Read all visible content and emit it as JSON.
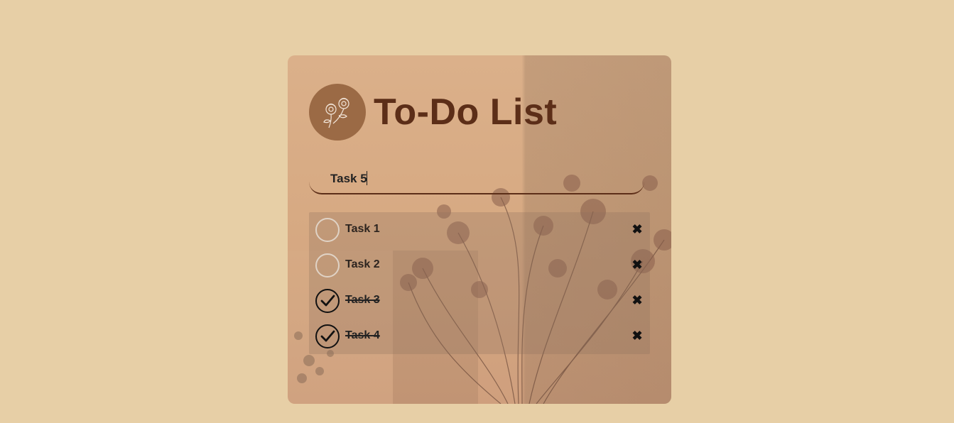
{
  "app": {
    "title": "To-Do List",
    "logo_icon": "flower-icon"
  },
  "input": {
    "value": "Task 5",
    "placeholder": ""
  },
  "tasks": [
    {
      "label": "Task 1",
      "completed": false,
      "delete_icon": "close-icon"
    },
    {
      "label": "Task 2",
      "completed": false,
      "delete_icon": "close-icon"
    },
    {
      "label": "Task 3",
      "completed": true,
      "delete_icon": "close-icon"
    },
    {
      "label": "Task 4",
      "completed": true,
      "delete_icon": "close-icon"
    }
  ],
  "colors": {
    "page_background": "#e7cfa6",
    "title": "#5c2e18",
    "logo_circle": "#9b6a45",
    "input_underline": "#5c2e18"
  }
}
